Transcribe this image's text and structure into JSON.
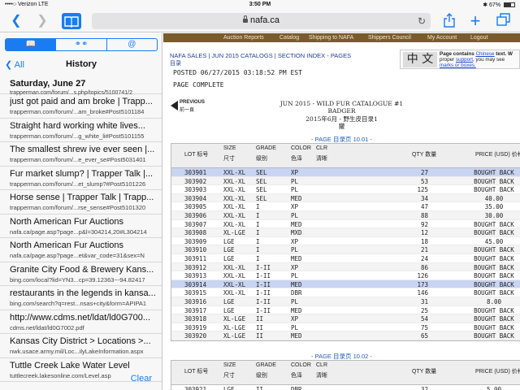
{
  "status": {
    "carrier": "••••○ Verizon  LTE",
    "time": "3:50 PM",
    "battery": "67%"
  },
  "toolbar": {
    "url": "nafa.ca"
  },
  "sidebar": {
    "segments": [
      "book",
      "reading-list",
      "shared-links"
    ],
    "back_label": "All",
    "title": "History",
    "day_label": "Saturday, June 27",
    "day_sub": "trapperman.com/forum/...s.php/topics/5100741/2",
    "items": [
      {
        "title": "just got paid and am broke | Trapp...",
        "url": "trapperman.com/forum/...am_broke#Post5101184"
      },
      {
        "title": "Straight hard working white lives...",
        "url": "trapperman.com/forum/...g_white_li#Post5101155"
      },
      {
        "title": "The smallest shrew ive ever seen |...",
        "url": "trapperman.com/forum/...e_ever_se#Post5031401"
      },
      {
        "title": "Fur market slump? | Trapper Talk |...",
        "url": "trapperman.com/forum/...et_slump?#Post5101226"
      },
      {
        "title": "Horse sense | Trapper Talk | Trapp...",
        "url": "trapperman.com/forum/...rse_sense#Post5101320"
      },
      {
        "title": "North American Fur Auctions",
        "url": "nafa.ca/page.asp?page...p&l=304214,20#L304214"
      },
      {
        "title": "North American Fur Auctions",
        "url": "nafa.ca/page.asp?page...et&var_code=31&sex=N"
      },
      {
        "title": "Granite City Food & Brewery Kans...",
        "url": "bing.com/local?lid=YN3...cp=39.12363~-94.82417"
      },
      {
        "title": "restaurants in the legends in kansa...",
        "url": "bing.com/search?q=rest...nsas+city&form=APIPA1"
      },
      {
        "title": "http://www.cdms.net/ldat/ld0G700...",
        "url": "cdms.net/ldat/ld0G7002.pdf"
      },
      {
        "title": "Kansas City District > Locations >...",
        "url": "nwk.usace.army.mil/Loc...ilyLakeInformation.aspx"
      },
      {
        "title": "Tuttle Creek Lake Water Level",
        "url": "tuttlecreek.lakesonline.com/Level.asp"
      }
    ],
    "clear_label": "Clear"
  },
  "page": {
    "nav": [
      "Auction Reports",
      "Catalog",
      "Shipping to NAFA",
      "Shippers Council",
      "My Account",
      "Logout"
    ],
    "breadcrumb": "NAFA SALES | JUN 2015 CATALOGS | SECTION INDEX - PAGES",
    "breadcrumb_zh": "目录",
    "posted": "POSTED 06/27/2015 03:18:52 PM EST",
    "complete": "PAGE COMPLETE",
    "chinese_box": {
      "zh": "中 文",
      "line1a": "Page contains ",
      "line1b": "Chinese",
      "line1c": " text. W",
      "line2a": "proper ",
      "line2b": "support",
      "line2c": ", you may see ",
      "line3": "marks or boxes."
    },
    "prev": {
      "label": "PREVIOUS",
      "label_zh": "前一頁"
    },
    "catalogue": {
      "line1": "JUN 2015 - WILD FUR CATALOGUE #1",
      "line2": "BADGER",
      "line3": "2015年6月 - 野生皮目录1",
      "line4": "獾"
    },
    "page1_label": "- PAGE 目录页 10.01 -",
    "page2_label": "- PAGE 目录页 10.02 -",
    "headers": {
      "lot": "LOT 标号",
      "size": "SIZE",
      "size_zh": "尺寸",
      "grade": "GRADE",
      "grade_zh": "级别",
      "color": "COLOR",
      "color_zh": "色泽",
      "clr": "CLR",
      "clr_zh": "清晰",
      "qty": "QTY 数量",
      "price": "PRICE (USD) 价格"
    },
    "rows1": [
      {
        "lot": "303901",
        "size": "XXL-XL",
        "grade": "SEL",
        "color": "XP",
        "qty": "27",
        "price": "BOUGHT BACK"
      },
      {
        "lot": "303902",
        "size": "XXL-XL",
        "grade": "SEL",
        "color": "PL",
        "qty": "53",
        "price": "BOUGHT BACK"
      },
      {
        "lot": "303903",
        "size": "XXL-XL",
        "grade": "SEL",
        "color": "PL",
        "qty": "125",
        "price": "BOUGHT BACK"
      },
      {
        "lot": "303904",
        "size": "XXL-XL",
        "grade": "SEL",
        "color": "MED",
        "qty": "34",
        "price": "40.00"
      },
      {
        "lot": "303905",
        "size": "XXL-XL",
        "grade": "I",
        "color": "XP",
        "qty": "47",
        "price": "35.00"
      },
      {
        "lot": "303906",
        "size": "XXL-XL",
        "grade": "I",
        "color": "PL",
        "qty": "88",
        "price": "30.00"
      },
      {
        "lot": "303907",
        "size": "XXL-XL",
        "grade": "I",
        "color": "MED",
        "qty": "92",
        "price": "BOUGHT BACK"
      },
      {
        "lot": "303908",
        "size": "XL-LGE",
        "grade": "I",
        "color": "MXD",
        "qty": "12",
        "price": "BOUGHT BACK"
      },
      {
        "lot": "303909",
        "size": "LGE",
        "grade": "I",
        "color": "XP",
        "qty": "18",
        "price": "45.00"
      },
      {
        "lot": "303910",
        "size": "LGE",
        "grade": "I",
        "color": "PL",
        "qty": "21",
        "price": "BOUGHT BACK"
      },
      {
        "lot": "303911",
        "size": "LGE",
        "grade": "I",
        "color": "MED",
        "qty": "24",
        "price": "BOUGHT BACK"
      },
      {
        "lot": "303912",
        "size": "XXL-XL",
        "grade": "I-II",
        "color": "XP",
        "qty": "86",
        "price": "BOUGHT BACK"
      },
      {
        "lot": "303913",
        "size": "XXL-XL",
        "grade": "I-II",
        "color": "PL",
        "qty": "126",
        "price": "BOUGHT BACK"
      },
      {
        "lot": "303914",
        "size": "XXL-XL",
        "grade": "I-II",
        "color": "MED",
        "qty": "173",
        "price": "BOUGHT BACK"
      },
      {
        "lot": "303915",
        "size": "XXL-XL",
        "grade": "I-II",
        "color": "DBR",
        "qty": "146",
        "price": "BOUGHT BACK"
      },
      {
        "lot": "303916",
        "size": "LGE",
        "grade": "I-II",
        "color": "PL",
        "qty": "31",
        "price": "8.00"
      },
      {
        "lot": "303917",
        "size": "LGE",
        "grade": "I-II",
        "color": "MED",
        "qty": "25",
        "price": "BOUGHT BACK"
      },
      {
        "lot": "303918",
        "size": "XL-LGE",
        "grade": "II",
        "color": "XP",
        "qty": "54",
        "price": "BOUGHT BACK"
      },
      {
        "lot": "303919",
        "size": "XL-LGE",
        "grade": "II",
        "color": "PL",
        "qty": "75",
        "price": "BOUGHT BACK"
      },
      {
        "lot": "303920",
        "size": "XL-LGE",
        "grade": "II",
        "color": "MED",
        "qty": "65",
        "price": "BOUGHT BACK"
      }
    ],
    "rows2": [
      {
        "lot": "303921",
        "size": "LGE",
        "grade": "II",
        "color": "DBR",
        "qty": "32",
        "price": "5.00"
      },
      {
        "lot": "303922",
        "size": "LGE",
        "grade": "II",
        "color": "DBR",
        "qty": "24",
        "price": "BOUGHT BACK"
      }
    ]
  }
}
